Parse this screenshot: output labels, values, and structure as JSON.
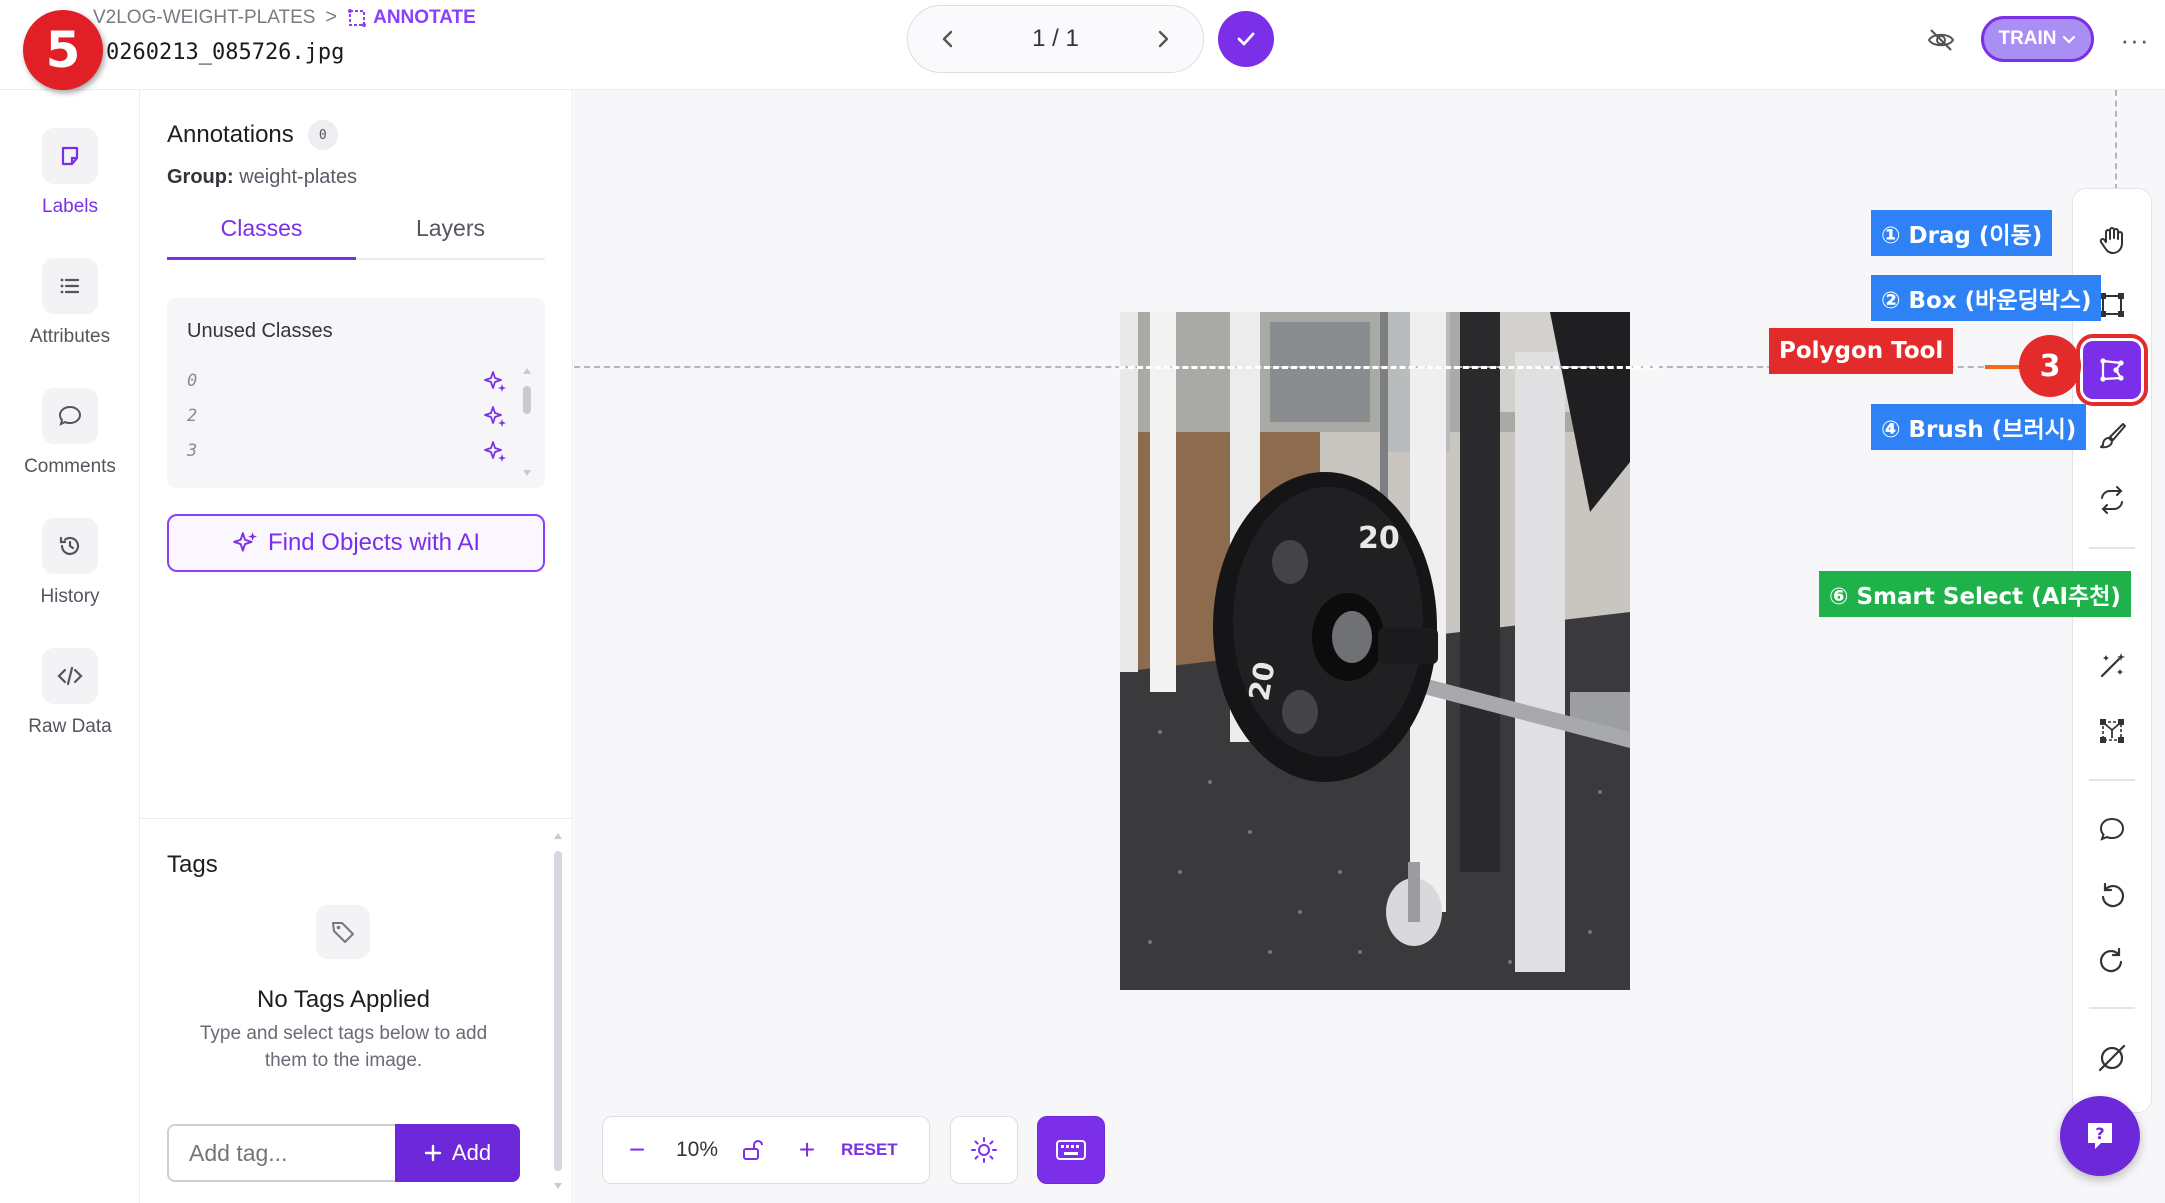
{
  "step_badge": "5",
  "header": {
    "project": "V2LOG-WEIGHT-PLATES",
    "separator": ">",
    "current": "ANNOTATE",
    "filename": "0260213_085726.jpg",
    "pager": "1 / 1",
    "train_label": "TRAIN",
    "more": "···"
  },
  "left_rail": [
    {
      "label": "Labels",
      "icon": "labels-icon"
    },
    {
      "label": "Attributes",
      "icon": "list-icon"
    },
    {
      "label": "Comments",
      "icon": "comment-icon"
    },
    {
      "label": "History",
      "icon": "history-icon"
    },
    {
      "label": "Raw Data",
      "icon": "code-icon"
    }
  ],
  "panel": {
    "title": "Annotations",
    "count": "0",
    "group_label": "Group:",
    "group_value": "weight-plates",
    "tabs": [
      "Classes",
      "Layers"
    ],
    "unused_classes_heading": "Unused Classes",
    "classes": [
      "0",
      "2",
      "3"
    ],
    "find_ai_label": "Find Objects with AI"
  },
  "tags": {
    "title": "Tags",
    "empty_title": "No Tags Applied",
    "empty_desc": "Type and select tags below to add them to the image.",
    "input_placeholder": "Add tag...",
    "add_label": "Add"
  },
  "toolbar": {
    "zoom": "10%",
    "minus": "−",
    "plus": "+",
    "reset": "RESET"
  },
  "callouts": {
    "drag": "① Drag (이동)",
    "box": "② Box (바운딩박스)",
    "polygon": "Polygon Tool",
    "brush": "④ Brush (브러시)",
    "smart": "⑥ Smart Select (AI추천)",
    "pointer": "3"
  },
  "colors": {
    "accent": "#7c2fe8",
    "callout_blue": "#2f82f5",
    "callout_green": "#1fb24a",
    "callout_red": "#e32b2b"
  },
  "image": {
    "plate_label": "20"
  }
}
